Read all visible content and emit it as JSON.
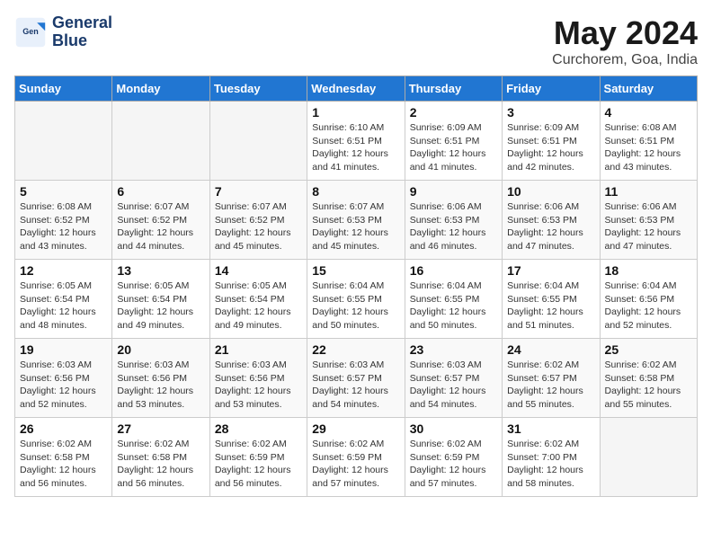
{
  "header": {
    "logo_line1": "General",
    "logo_line2": "Blue",
    "title": "May 2024",
    "subtitle": "Curchorem, Goa, India"
  },
  "weekdays": [
    "Sunday",
    "Monday",
    "Tuesday",
    "Wednesday",
    "Thursday",
    "Friday",
    "Saturday"
  ],
  "weeks": [
    [
      {
        "day": "",
        "info": ""
      },
      {
        "day": "",
        "info": ""
      },
      {
        "day": "",
        "info": ""
      },
      {
        "day": "1",
        "info": "Sunrise: 6:10 AM\nSunset: 6:51 PM\nDaylight: 12 hours\nand 41 minutes."
      },
      {
        "day": "2",
        "info": "Sunrise: 6:09 AM\nSunset: 6:51 PM\nDaylight: 12 hours\nand 41 minutes."
      },
      {
        "day": "3",
        "info": "Sunrise: 6:09 AM\nSunset: 6:51 PM\nDaylight: 12 hours\nand 42 minutes."
      },
      {
        "day": "4",
        "info": "Sunrise: 6:08 AM\nSunset: 6:51 PM\nDaylight: 12 hours\nand 43 minutes."
      }
    ],
    [
      {
        "day": "5",
        "info": "Sunrise: 6:08 AM\nSunset: 6:52 PM\nDaylight: 12 hours\nand 43 minutes."
      },
      {
        "day": "6",
        "info": "Sunrise: 6:07 AM\nSunset: 6:52 PM\nDaylight: 12 hours\nand 44 minutes."
      },
      {
        "day": "7",
        "info": "Sunrise: 6:07 AM\nSunset: 6:52 PM\nDaylight: 12 hours\nand 45 minutes."
      },
      {
        "day": "8",
        "info": "Sunrise: 6:07 AM\nSunset: 6:53 PM\nDaylight: 12 hours\nand 45 minutes."
      },
      {
        "day": "9",
        "info": "Sunrise: 6:06 AM\nSunset: 6:53 PM\nDaylight: 12 hours\nand 46 minutes."
      },
      {
        "day": "10",
        "info": "Sunrise: 6:06 AM\nSunset: 6:53 PM\nDaylight: 12 hours\nand 47 minutes."
      },
      {
        "day": "11",
        "info": "Sunrise: 6:06 AM\nSunset: 6:53 PM\nDaylight: 12 hours\nand 47 minutes."
      }
    ],
    [
      {
        "day": "12",
        "info": "Sunrise: 6:05 AM\nSunset: 6:54 PM\nDaylight: 12 hours\nand 48 minutes."
      },
      {
        "day": "13",
        "info": "Sunrise: 6:05 AM\nSunset: 6:54 PM\nDaylight: 12 hours\nand 49 minutes."
      },
      {
        "day": "14",
        "info": "Sunrise: 6:05 AM\nSunset: 6:54 PM\nDaylight: 12 hours\nand 49 minutes."
      },
      {
        "day": "15",
        "info": "Sunrise: 6:04 AM\nSunset: 6:55 PM\nDaylight: 12 hours\nand 50 minutes."
      },
      {
        "day": "16",
        "info": "Sunrise: 6:04 AM\nSunset: 6:55 PM\nDaylight: 12 hours\nand 50 minutes."
      },
      {
        "day": "17",
        "info": "Sunrise: 6:04 AM\nSunset: 6:55 PM\nDaylight: 12 hours\nand 51 minutes."
      },
      {
        "day": "18",
        "info": "Sunrise: 6:04 AM\nSunset: 6:56 PM\nDaylight: 12 hours\nand 52 minutes."
      }
    ],
    [
      {
        "day": "19",
        "info": "Sunrise: 6:03 AM\nSunset: 6:56 PM\nDaylight: 12 hours\nand 52 minutes."
      },
      {
        "day": "20",
        "info": "Sunrise: 6:03 AM\nSunset: 6:56 PM\nDaylight: 12 hours\nand 53 minutes."
      },
      {
        "day": "21",
        "info": "Sunrise: 6:03 AM\nSunset: 6:56 PM\nDaylight: 12 hours\nand 53 minutes."
      },
      {
        "day": "22",
        "info": "Sunrise: 6:03 AM\nSunset: 6:57 PM\nDaylight: 12 hours\nand 54 minutes."
      },
      {
        "day": "23",
        "info": "Sunrise: 6:03 AM\nSunset: 6:57 PM\nDaylight: 12 hours\nand 54 minutes."
      },
      {
        "day": "24",
        "info": "Sunrise: 6:02 AM\nSunset: 6:57 PM\nDaylight: 12 hours\nand 55 minutes."
      },
      {
        "day": "25",
        "info": "Sunrise: 6:02 AM\nSunset: 6:58 PM\nDaylight: 12 hours\nand 55 minutes."
      }
    ],
    [
      {
        "day": "26",
        "info": "Sunrise: 6:02 AM\nSunset: 6:58 PM\nDaylight: 12 hours\nand 56 minutes."
      },
      {
        "day": "27",
        "info": "Sunrise: 6:02 AM\nSunset: 6:58 PM\nDaylight: 12 hours\nand 56 minutes."
      },
      {
        "day": "28",
        "info": "Sunrise: 6:02 AM\nSunset: 6:59 PM\nDaylight: 12 hours\nand 56 minutes."
      },
      {
        "day": "29",
        "info": "Sunrise: 6:02 AM\nSunset: 6:59 PM\nDaylight: 12 hours\nand 57 minutes."
      },
      {
        "day": "30",
        "info": "Sunrise: 6:02 AM\nSunset: 6:59 PM\nDaylight: 12 hours\nand 57 minutes."
      },
      {
        "day": "31",
        "info": "Sunrise: 6:02 AM\nSunset: 7:00 PM\nDaylight: 12 hours\nand 58 minutes."
      },
      {
        "day": "",
        "info": ""
      }
    ]
  ]
}
